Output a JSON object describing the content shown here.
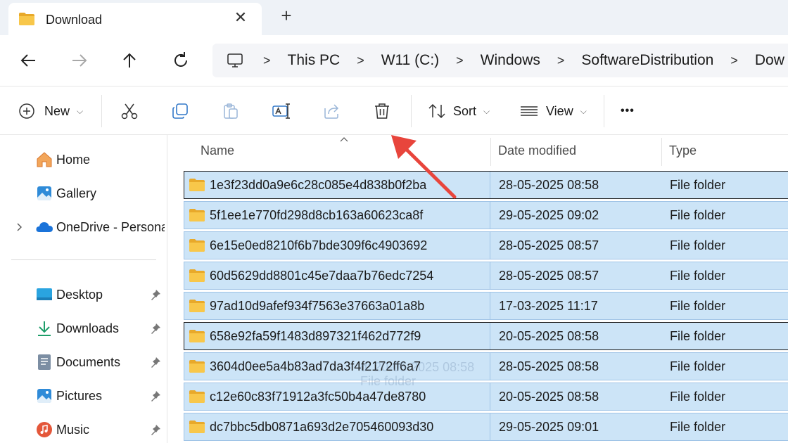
{
  "window": {
    "tab_title": "Download",
    "tab_close_glyph": "✕",
    "new_tab_glyph": "+"
  },
  "nav": {
    "back_icon": "arrow-left-icon",
    "forward_icon": "arrow-right-icon",
    "up_icon": "arrow-up-icon",
    "refresh_icon": "refresh-icon"
  },
  "address": {
    "crumbs": [
      "This PC",
      "W11 (C:)",
      "Windows",
      "SoftwareDistribution",
      "Dow"
    ],
    "separator": ">"
  },
  "toolbar": {
    "new_label": "New",
    "sort_label": "Sort",
    "view_label": "View",
    "more_glyph": "•••",
    "icons": [
      "cut-icon",
      "copy-icon",
      "paste-icon",
      "rename-icon",
      "share-icon",
      "delete-icon"
    ]
  },
  "sidebar": {
    "items": [
      {
        "label": "Home",
        "icon": "home-icon"
      },
      {
        "label": "Gallery",
        "icon": "gallery-icon"
      },
      {
        "label": "OneDrive - Persona",
        "icon": "onedrive-icon"
      },
      {
        "label": "Desktop",
        "icon": "desktop-icon"
      },
      {
        "label": "Downloads",
        "icon": "downloads-icon"
      },
      {
        "label": "Documents",
        "icon": "documents-icon"
      },
      {
        "label": "Pictures",
        "icon": "pictures-icon"
      },
      {
        "label": "Music",
        "icon": "music-icon"
      }
    ]
  },
  "columns": {
    "name": "Name",
    "date": "Date modified",
    "type": "Type"
  },
  "files": [
    {
      "name": "1e3f23dd0a9e6c28c085e4d838b0f2ba",
      "date": "28-05-2025 08:58",
      "type": "File folder"
    },
    {
      "name": "5f1ee1e770fd298d8cb163a60623ca8f",
      "date": "29-05-2025 09:02",
      "type": "File folder"
    },
    {
      "name": "6e15e0ed8210f6b7bde309f6c4903692",
      "date": "28-05-2025 08:57",
      "type": "File folder"
    },
    {
      "name": "60d5629dd8801c45e7daa7b76edc7254",
      "date": "28-05-2025 08:57",
      "type": "File folder"
    },
    {
      "name": "97ad10d9afef934f7563e37663a01a8b",
      "date": "17-03-2025 11:17",
      "type": "File folder"
    },
    {
      "name": "658e92fa59f1483d897321f462d772f9",
      "date": "20-05-2025 08:58",
      "type": "File folder"
    },
    {
      "name": "3604d0ee5a4b83ad7da3f4f2172ff6a7",
      "date": "28-05-2025 08:58",
      "type": "File folder"
    },
    {
      "name": "c12e60c83f71912a3fc50b4a47de8780",
      "date": "20-05-2025 08:58",
      "type": "File folder"
    },
    {
      "name": "dc7bbc5db0871a693d2e705460093d30",
      "date": "29-05-2025 09:01",
      "type": "File folder"
    }
  ],
  "ghost_tooltip": [
    "d: 20-05-2025 08:58",
    "File folder"
  ],
  "colors": {
    "selection": "#cce4f7",
    "selection_border": "#9fc3e6",
    "annotation_arrow": "#e8453c",
    "folder": "#f8c74a"
  }
}
